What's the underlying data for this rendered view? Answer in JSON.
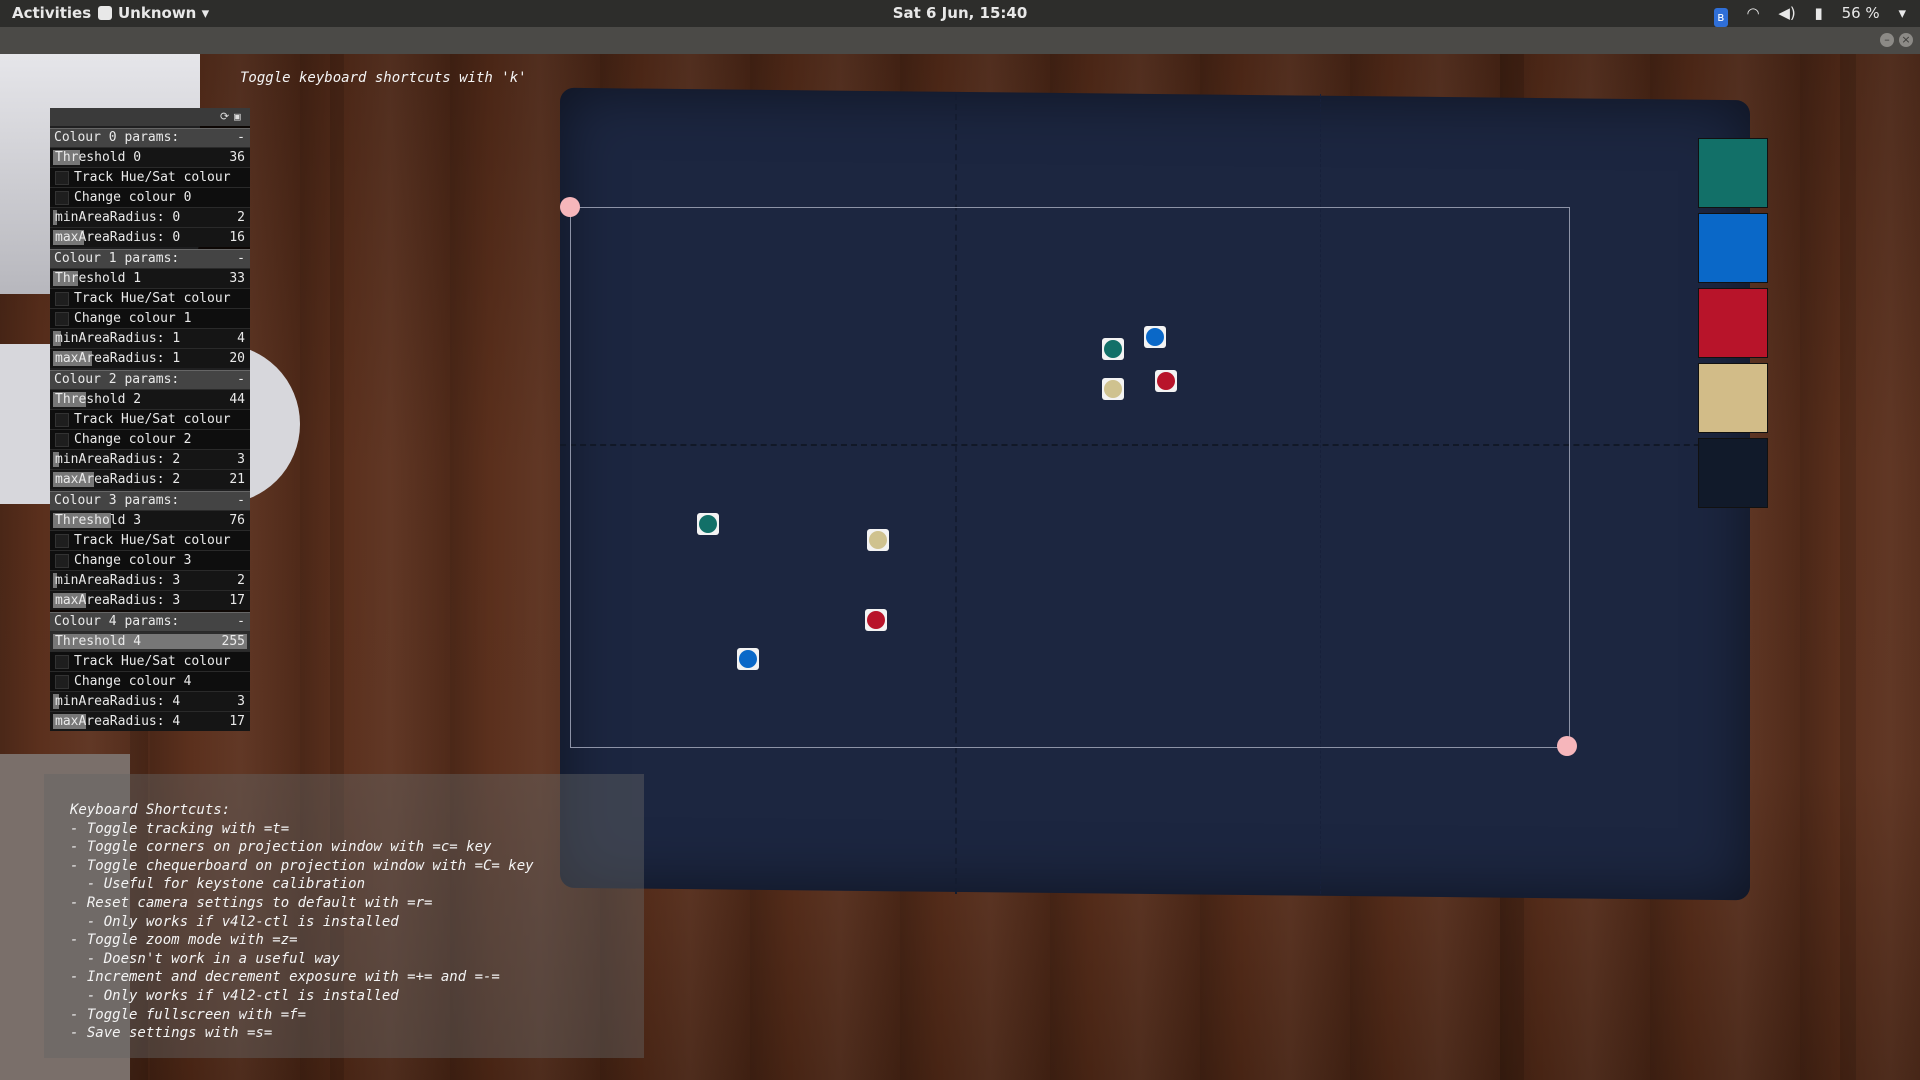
{
  "topbar": {
    "activities": "Activities",
    "app_name": "Unknown",
    "clock": "Sat  6 Jun, 15:40",
    "bluetooth_glyph": "ʙ",
    "battery": "56 %"
  },
  "icons": {
    "bluetooth": "bluetooth-icon",
    "wifi": "wifi-icon",
    "volume": "volume-icon",
    "battery": "battery-icon"
  },
  "overlay_hint": "Toggle keyboard shortcuts with 'k'",
  "panel": {
    "groups": [
      {
        "title": "Colour 0 params:",
        "collapse": "-",
        "threshold_label": "Threshold 0",
        "threshold": 36,
        "threshold_fraction": 0.14,
        "track": "Track Hue/Sat colour",
        "change": "Change colour 0",
        "min_label": "minAreaRadius: 0",
        "min": 2,
        "min_fraction": 0.02,
        "max_label": "maxAreaRadius: 0",
        "max": 16,
        "max_fraction": 0.16
      },
      {
        "title": "Colour 1 params:",
        "collapse": "-",
        "threshold_label": "Threshold 1",
        "threshold": 33,
        "threshold_fraction": 0.13,
        "track": "Track Hue/Sat colour",
        "change": "Change colour 1",
        "min_label": "minAreaRadius: 1",
        "min": 4,
        "min_fraction": 0.04,
        "max_label": "maxAreaRadius: 1",
        "max": 20,
        "max_fraction": 0.2
      },
      {
        "title": "Colour 2 params:",
        "collapse": "-",
        "threshold_label": "Threshold 2",
        "threshold": 44,
        "threshold_fraction": 0.17,
        "track": "Track Hue/Sat colour",
        "change": "Change colour 2",
        "min_label": "minAreaRadius: 2",
        "min": 3,
        "min_fraction": 0.03,
        "max_label": "maxAreaRadius: 2",
        "max": 21,
        "max_fraction": 0.21
      },
      {
        "title": "Colour 3 params:",
        "collapse": "-",
        "threshold_label": "Threshold 3",
        "threshold": 76,
        "threshold_fraction": 0.3,
        "track": "Track Hue/Sat colour",
        "change": "Change colour 3",
        "min_label": "minAreaRadius: 3",
        "min": 2,
        "min_fraction": 0.02,
        "max_label": "maxAreaRadius: 3",
        "max": 17,
        "max_fraction": 0.17
      },
      {
        "title": "Colour 4 params:",
        "collapse": "-",
        "threshold_label": "Threshold 4",
        "threshold": 255,
        "threshold_fraction": 1.0,
        "track": "Track Hue/Sat colour",
        "change": "Change colour 4",
        "min_label": "minAreaRadius: 4",
        "min": 3,
        "min_fraction": 0.03,
        "max_label": "maxAreaRadius: 4",
        "max": 17,
        "max_fraction": 0.17
      }
    ]
  },
  "swatches": [
    "#127068",
    "#0a68c8",
    "#b8142a",
    "#d2bc88",
    "#111a2a"
  ],
  "markers": [
    {
      "color": "#127068"
    },
    {
      "color": "#0a68c8"
    },
    {
      "color": "#cfc28f"
    },
    {
      "color": "#b8142a"
    },
    {
      "color": "#127068"
    },
    {
      "color": "#cfc28f"
    },
    {
      "color": "#b8142a"
    },
    {
      "color": "#0a68c8"
    }
  ],
  "shortcuts": {
    "lines": [
      "Keyboard Shortcuts:",
      "- Toggle tracking with =t=",
      "- Toggle corners on projection window with =c= key",
      "- Toggle chequerboard on projection window with =C= key",
      "  - Useful for keystone calibration",
      "- Reset camera settings to default with =r=",
      "  - Only works if v4l2-ctl is installed",
      "- Toggle zoom mode with =z=",
      "  - Doesn't work in a useful way",
      "- Increment and decrement exposure with =+= and =-=",
      "  - Only works if v4l2-ctl is installed",
      "- Toggle fullscreen with =f=",
      "- Save settings with =s="
    ]
  }
}
